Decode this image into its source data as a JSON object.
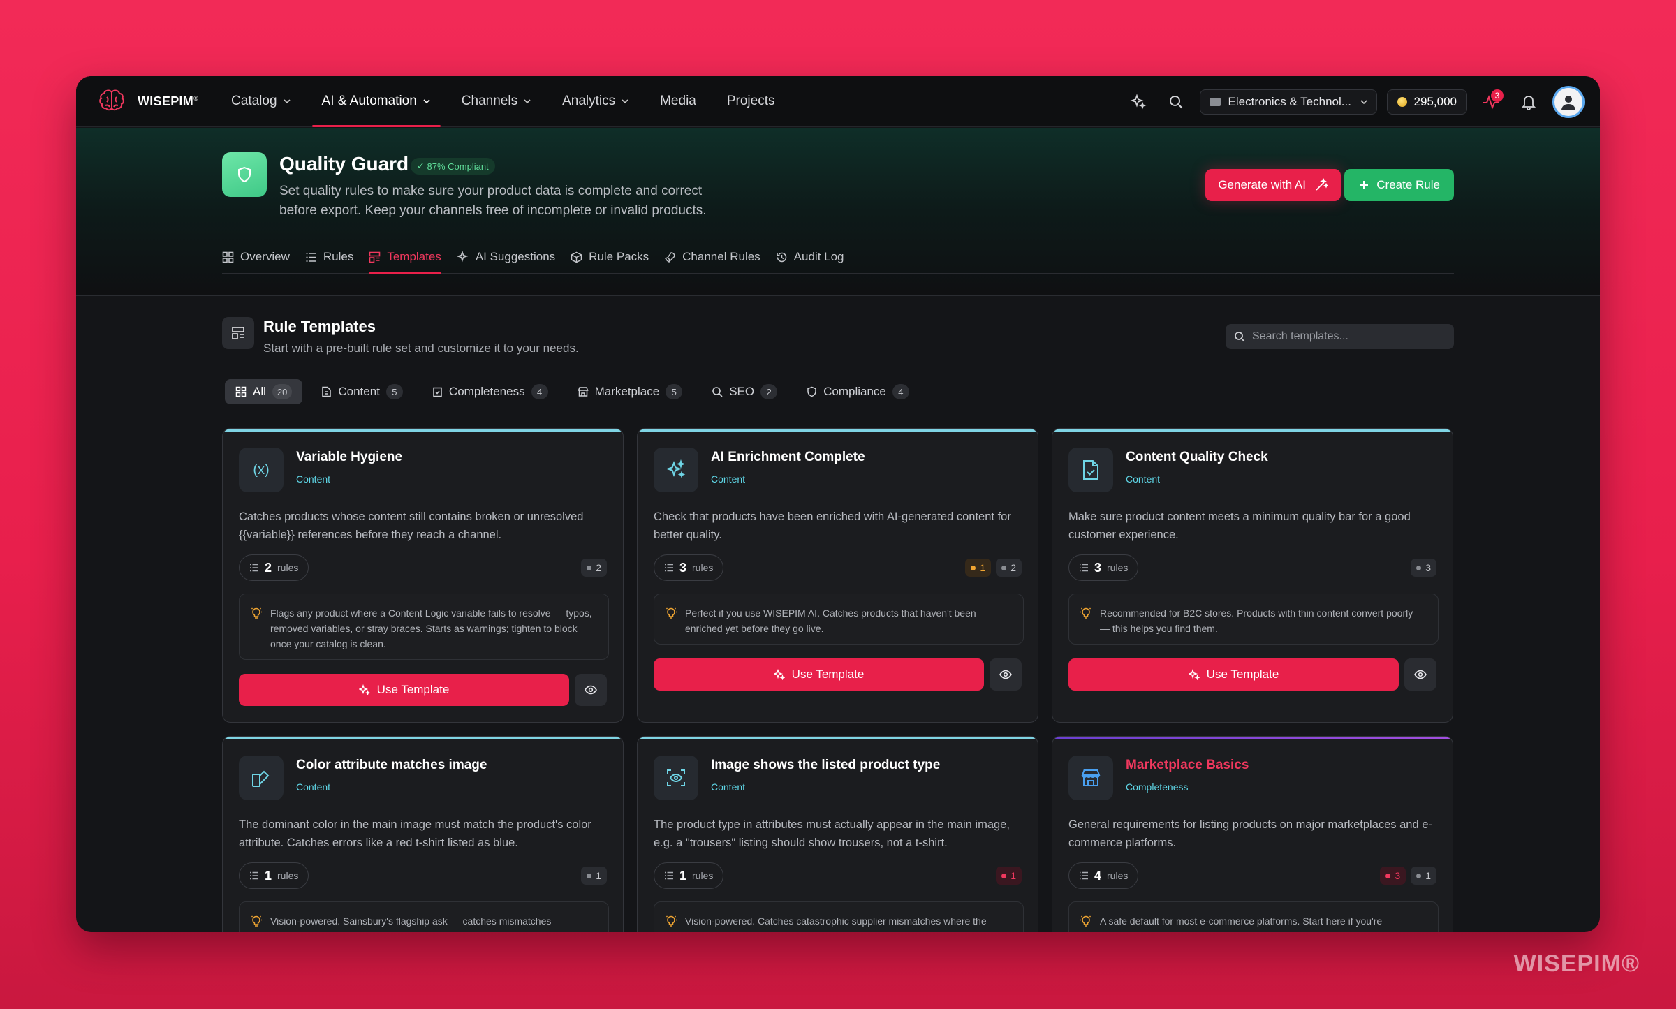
{
  "brand": {
    "name": "WISEPIM",
    "mark": "®"
  },
  "nav": [
    {
      "label": "Catalog",
      "dropdown": true,
      "active": false
    },
    {
      "label": "AI & Automation",
      "dropdown": true,
      "active": true
    },
    {
      "label": "Channels",
      "dropdown": true,
      "active": false
    },
    {
      "label": "Analytics",
      "dropdown": true,
      "active": false
    },
    {
      "label": "Media",
      "dropdown": false,
      "active": false
    },
    {
      "label": "Projects",
      "dropdown": false,
      "active": false
    }
  ],
  "topbar": {
    "store": "Electronics & Technol...",
    "credits": "295,000",
    "activity_badge": "3"
  },
  "hero": {
    "title": "Quality Guard",
    "compliance": "87% Compliant",
    "description": "Set quality rules to make sure your product data is complete and correct before export. Keep your channels free of incomplete or invalid products.",
    "generate_label": "Generate with AI",
    "create_label": "Create Rule"
  },
  "tabs": [
    {
      "label": "Overview",
      "icon": "grid-icon"
    },
    {
      "label": "Rules",
      "icon": "list-icon"
    },
    {
      "label": "Templates",
      "icon": "template-icon",
      "active": true
    },
    {
      "label": "AI Suggestions",
      "icon": "sparkle-icon"
    },
    {
      "label": "Rule Packs",
      "icon": "package-icon"
    },
    {
      "label": "Channel Rules",
      "icon": "rocket-icon"
    },
    {
      "label": "Audit Log",
      "icon": "history-icon"
    }
  ],
  "section": {
    "title": "Rule Templates",
    "subtitle": "Start with a pre-built rule set and customize it to your needs.",
    "search_placeholder": "Search templates..."
  },
  "filters": [
    {
      "label": "All",
      "count": "20",
      "active": true
    },
    {
      "label": "Content",
      "count": "5"
    },
    {
      "label": "Completeness",
      "count": "4"
    },
    {
      "label": "Marketplace",
      "count": "5"
    },
    {
      "label": "SEO",
      "count": "2"
    },
    {
      "label": "Compliance",
      "count": "4"
    }
  ],
  "cards": [
    {
      "title": "Variable Hygiene",
      "category": "Content",
      "icon": "variable-icon",
      "description": "Catches products whose content still contains broken or unresolved {{variable}} references before they reach a channel.",
      "rules": "2",
      "rules_label": "rules",
      "warning": "",
      "info": "2",
      "tip": "Flags any product where a Content Logic variable fails to resolve — typos, removed variables, or stray braces. Starts as warnings; tighten to block once your catalog is clean.",
      "use_label": "Use Template"
    },
    {
      "title": "AI Enrichment Complete",
      "category": "Content",
      "icon": "sparkles-icon",
      "description": "Check that products have been enriched with AI-generated content for better quality.",
      "rules": "3",
      "rules_label": "rules",
      "warning": "1",
      "info": "2",
      "tip": "Perfect if you use WISEPIM AI. Catches products that haven't been enriched yet before they go live.",
      "use_label": "Use Template"
    },
    {
      "title": "Content Quality Check",
      "category": "Content",
      "icon": "file-check-icon",
      "description": "Make sure product content meets a minimum quality bar for a good customer experience.",
      "rules": "3",
      "rules_label": "rules",
      "warning": "",
      "info": "3",
      "tip": "Recommended for B2C stores. Products with thin content convert poorly — this helps you find them.",
      "use_label": "Use Template"
    },
    {
      "title": "Color attribute matches image",
      "category": "Content",
      "icon": "swatch-icon",
      "description": "The dominant color in the main image must match the product's color attribute. Catches errors like a red t-shirt listed as blue.",
      "rules": "1",
      "rules_label": "rules",
      "info": "1",
      "tip": "Vision-powered. Sainsbury's flagship ask — catches mismatches"
    },
    {
      "title": "Image shows the listed product type",
      "category": "Content",
      "icon": "scan-eye-icon",
      "description": "The product type in attributes must actually appear in the main image, e.g. a \"trousers\" listing should show trousers, not a t-shirt.",
      "rules": "1",
      "rules_label": "rules",
      "error": "1",
      "tip": "Vision-powered. Catches catastrophic supplier mismatches where the"
    },
    {
      "title": "Marketplace Basics",
      "category": "Completeness",
      "icon": "store-icon",
      "description": "General requirements for listing products on major marketplaces and e-commerce platforms.",
      "rules": "4",
      "rules_label": "rules",
      "error": "3",
      "info": "1",
      "tip": "A safe default for most e-commerce platforms. Start here if you're"
    }
  ],
  "watermark": "WISEPIM®"
}
